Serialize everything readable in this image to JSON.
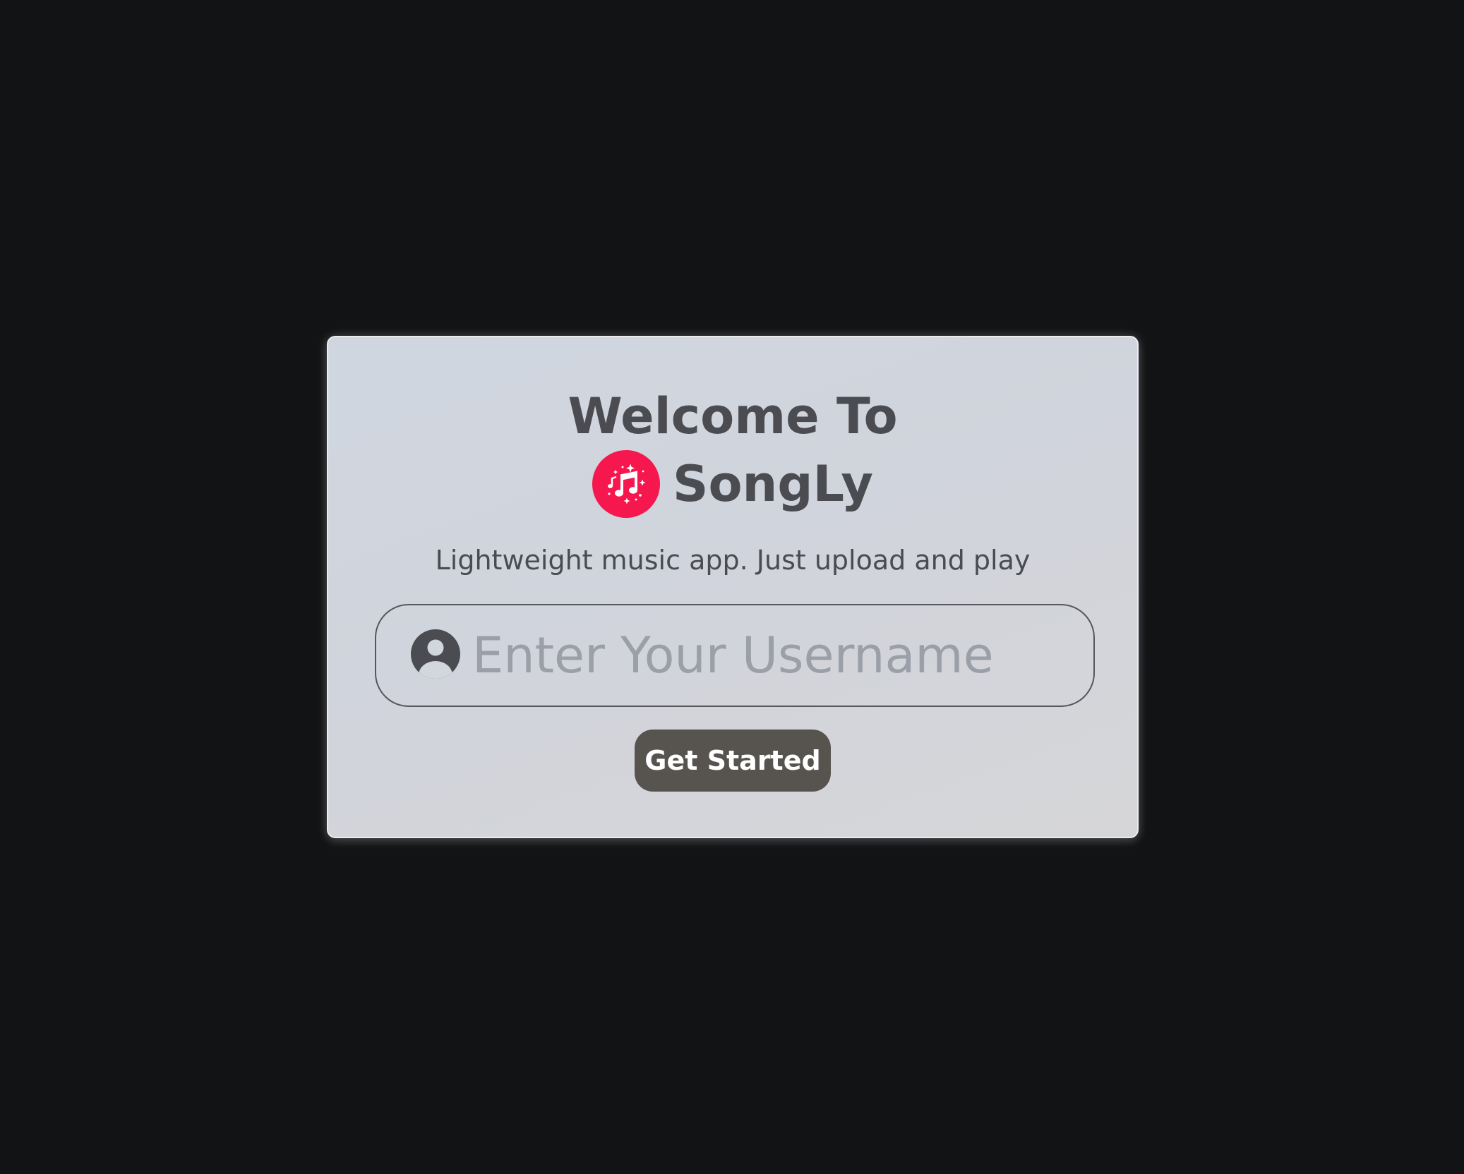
{
  "card": {
    "heading": "Welcome To",
    "brand": {
      "name": "SongLy",
      "logo_icon": "music-notes-sparkle-icon",
      "logo_color": "#f5174d"
    },
    "tagline": "Lightweight music app. Just upload and play",
    "username": {
      "icon": "user-circle-icon",
      "placeholder": "Enter Your Username",
      "value": ""
    },
    "cta_label": "Get Started"
  },
  "colors": {
    "background": "#121315",
    "text": "#4a4c51",
    "button": "#57534f"
  }
}
